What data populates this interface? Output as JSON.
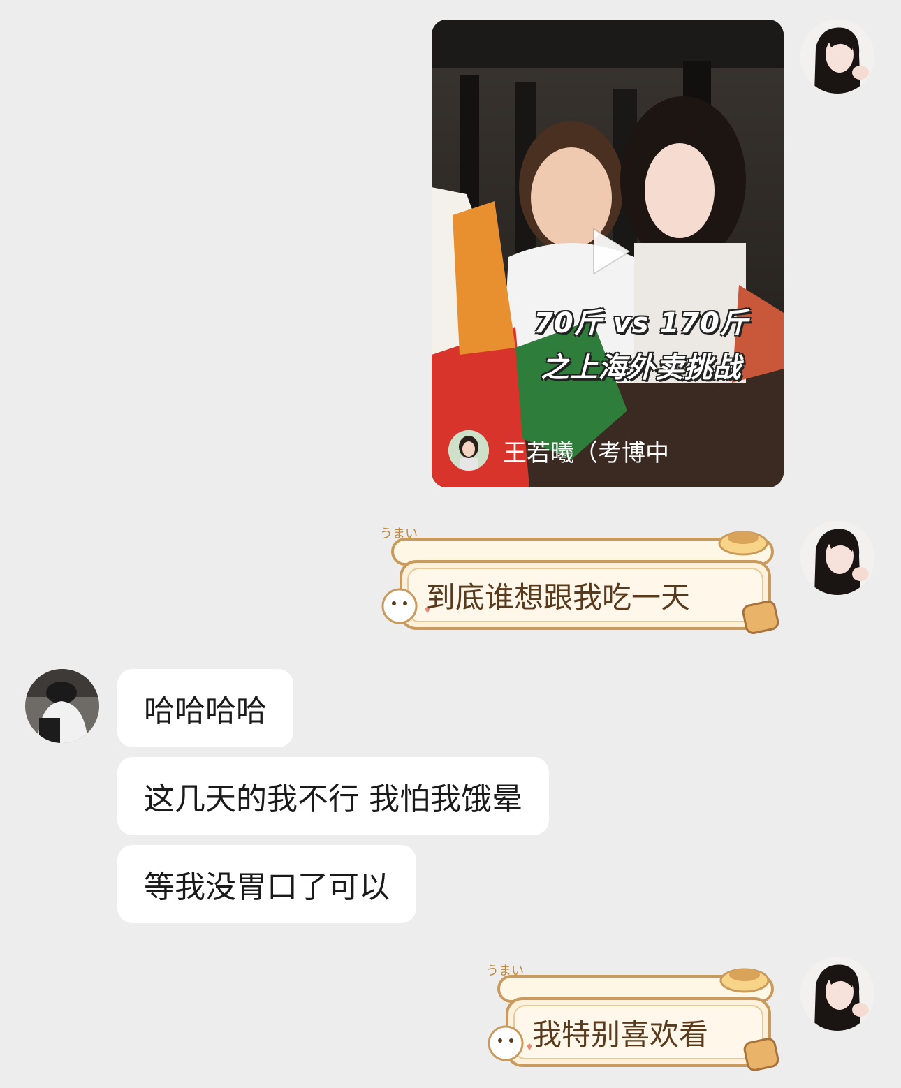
{
  "messages": {
    "video": {
      "caption_line1": "70斤 vs 170斤",
      "caption_line2": "之上海外卖挑战",
      "author": "王若曦（考博中"
    },
    "sticker1": {
      "text": "到底谁想跟我吃一天",
      "badge": "うまい"
    },
    "reply1": "哈哈哈哈",
    "reply2": "这几天的我不行 我怕我饿晕",
    "reply3": "等我没胃口了可以",
    "sticker2": {
      "text": "我特别喜欢看",
      "badge": "うまい"
    }
  },
  "icons": {
    "play": "play-icon"
  },
  "colors": {
    "background": "#ededed",
    "bubble": "#ffffff",
    "sticker_fill": "#fdf1dc",
    "sticker_border": "#c99a5b"
  }
}
